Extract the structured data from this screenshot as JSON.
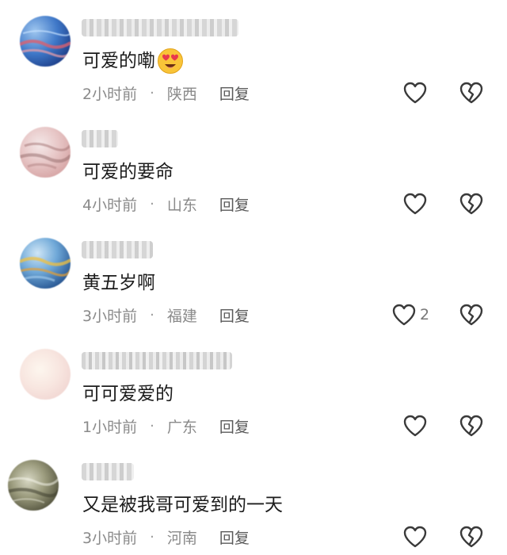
{
  "comments": [
    {
      "username": "",
      "content": "可爱的嘞",
      "content_emoji": "smiling-face-with-heart-eyes-icon",
      "time": "2小时前",
      "location": "陕西",
      "reply_label": "回复",
      "like_count": ""
    },
    {
      "username": "",
      "content": "可爱的要命",
      "content_emoji": "",
      "time": "4小时前",
      "location": "山东",
      "reply_label": "回复",
      "like_count": ""
    },
    {
      "username": "",
      "content": "黄五岁啊",
      "content_emoji": "",
      "time": "3小时前",
      "location": "福建",
      "reply_label": "回复",
      "like_count": "2"
    },
    {
      "username": "",
      "content": "可可爱爱的",
      "content_emoji": "",
      "time": "1小时前",
      "location": "广东",
      "reply_label": "回复",
      "like_count": ""
    },
    {
      "username": "",
      "content": "又是被我哥可爱到的一天",
      "content_emoji": "",
      "time": "3小时前",
      "location": "河南",
      "reply_label": "回复",
      "like_count": ""
    }
  ],
  "separator": "·",
  "icons": {
    "like": "heart-outline-icon",
    "dislike": "broken-heart-icon"
  },
  "colors": {
    "text": "#1c1c1c",
    "meta": "#8a8a8a",
    "icon": "#3a3a3a"
  }
}
